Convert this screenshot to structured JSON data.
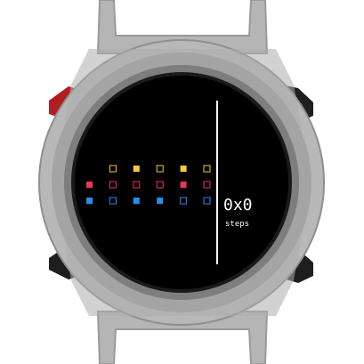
{
  "watch": {
    "case_color": "#a6a6a6",
    "bezel_color": "#7a7a7a",
    "screen_color": "#000000",
    "strap_color": "#b2b2b2",
    "accent_button_color": "#b01e23",
    "side_button_color": "#1e1e1e"
  },
  "display": {
    "value_text": "0x0",
    "unit_text": "steps",
    "divider_color": "#ffffff",
    "text_color": "#ffffff",
    "colors": {
      "top": "#f5c842",
      "middle": "#e8365a",
      "bottom": "#2b8ee6"
    },
    "rows": [
      {
        "color_key": "top",
        "cells": [
          null,
          false,
          true,
          false,
          true,
          false
        ]
      },
      {
        "color_key": "middle",
        "cells": [
          true,
          false,
          false,
          false,
          true,
          false
        ]
      },
      {
        "color_key": "bottom",
        "cells": [
          true,
          false,
          true,
          true,
          false,
          false
        ]
      }
    ]
  }
}
